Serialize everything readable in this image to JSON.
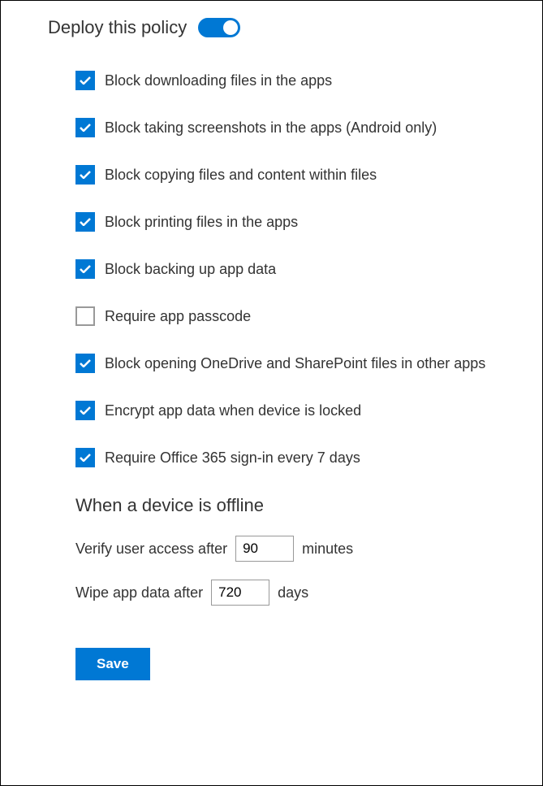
{
  "header": {
    "title": "Deploy this policy",
    "toggle_on": true
  },
  "options": [
    {
      "label": "Block downloading files in the apps",
      "checked": true
    },
    {
      "label": "Block taking screenshots in the apps (Android only)",
      "checked": true
    },
    {
      "label": "Block copying files and content within files",
      "checked": true
    },
    {
      "label": "Block printing files in the apps",
      "checked": true
    },
    {
      "label": "Block backing up app data",
      "checked": true
    },
    {
      "label": "Require app passcode",
      "checked": false
    },
    {
      "label": "Block opening OneDrive and SharePoint files in other apps",
      "checked": true
    },
    {
      "label": "Encrypt app data when device is locked",
      "checked": true
    },
    {
      "label": "Require Office 365 sign-in every 7 days",
      "checked": true
    }
  ],
  "offline": {
    "heading": "When a device is offline",
    "verify_prefix": "Verify user access after",
    "verify_value": "90",
    "verify_suffix": "minutes",
    "wipe_prefix": "Wipe app data after",
    "wipe_value": "720",
    "wipe_suffix": "days"
  },
  "save_label": "Save",
  "colors": {
    "primary": "#0078d4"
  }
}
